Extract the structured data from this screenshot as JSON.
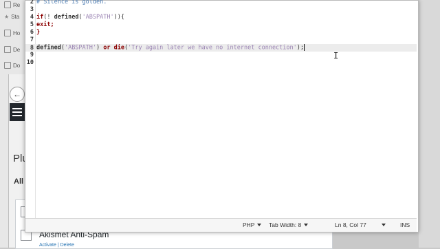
{
  "background": {
    "sidebar_items": [
      {
        "label": "Re",
        "icon": "refresh-icon"
      },
      {
        "label": "Sta",
        "icon": "star-icon"
      },
      {
        "label": "Ho",
        "icon": "home-icon"
      },
      {
        "label": "De",
        "icon": "desktop-icon"
      },
      {
        "label": "Do",
        "icon": "document-icon"
      }
    ],
    "page_title": "Plu",
    "filter_all": "All",
    "plugin_name": "Akismet Anti-Spam",
    "plugin_actions": "Activate | Delete"
  },
  "editor": {
    "lines": [
      {
        "n": "2",
        "text": "# Silence is golden."
      },
      {
        "n": "3",
        "text": ""
      },
      {
        "n": "4",
        "text": "if(! defined('ABSPATH')){"
      },
      {
        "n": "5",
        "text": "exit;"
      },
      {
        "n": "6",
        "text": "}"
      },
      {
        "n": "7",
        "text": ""
      },
      {
        "n": "8",
        "text": "defined('ABSPATH') or die('Try again later we have no internet connection');"
      },
      {
        "n": "9",
        "text": ""
      },
      {
        "n": "10",
        "text": ""
      }
    ]
  },
  "statusbar": {
    "language": "PHP",
    "tab_width": "Tab Width: 8",
    "position": "Ln 8, Col 77",
    "mode": "INS"
  }
}
